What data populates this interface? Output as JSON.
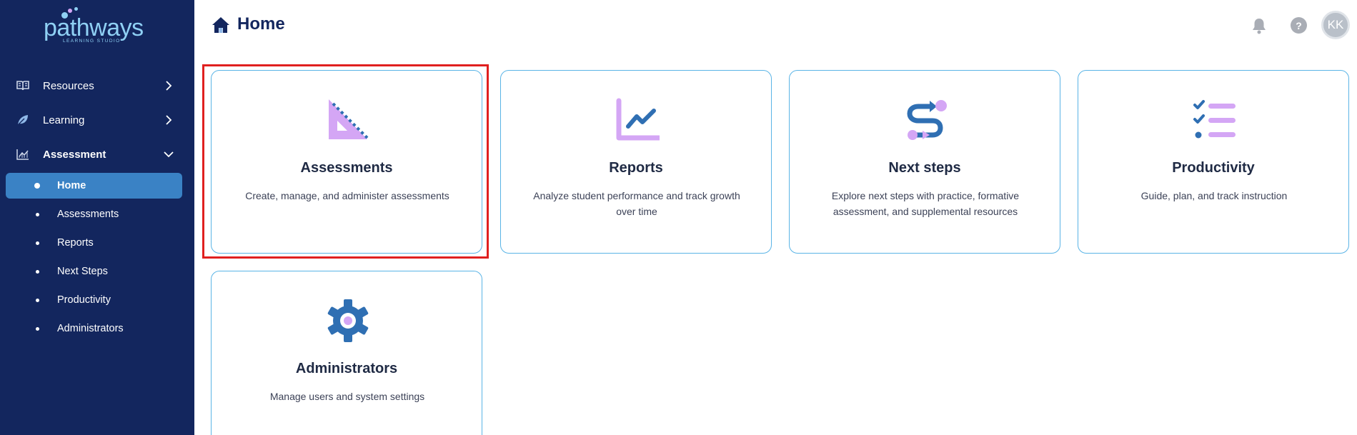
{
  "brand": {
    "word": "pathways",
    "sub": "LEARNING STUDIO"
  },
  "sidebar": {
    "items": [
      {
        "label": "Resources",
        "icon": "book-open-icon",
        "expanded": false
      },
      {
        "label": "Learning",
        "icon": "leaf-icon",
        "expanded": false
      },
      {
        "label": "Assessment",
        "icon": "chart-line-icon",
        "expanded": true
      }
    ],
    "sub_items": [
      {
        "label": "Home",
        "active": true
      },
      {
        "label": "Assessments",
        "active": false
      },
      {
        "label": "Reports",
        "active": false
      },
      {
        "label": "Next Steps",
        "active": false
      },
      {
        "label": "Productivity",
        "active": false
      },
      {
        "label": "Administrators",
        "active": false
      }
    ]
  },
  "header": {
    "title": "Home",
    "help_label": "?",
    "avatar_initials": "KK"
  },
  "cards": [
    {
      "title": "Assessments",
      "description": "Create, manage, and administer assessments",
      "icon": "triangle-ruler-icon",
      "selected": true
    },
    {
      "title": "Reports",
      "description": "Analyze student performance and track growth over time",
      "icon": "line-chart-icon",
      "selected": false
    },
    {
      "title": "Next steps",
      "description": "Explore next steps with practice, formative assessment, and supplemental resources",
      "icon": "route-icon",
      "selected": false
    },
    {
      "title": "Productivity",
      "description": "Guide, plan, and track instruction",
      "icon": "checklist-icon",
      "selected": false
    },
    {
      "title": "Administrators",
      "description": "Manage users and system settings",
      "icon": "gear-icon",
      "selected": false
    }
  ],
  "colors": {
    "sidebar_bg": "#13265e",
    "active_item": "#3a82c5",
    "card_border": "#5ab4e6",
    "icon_purple": "#d4a6f5",
    "icon_blue": "#2f6fb3",
    "highlight": "#e0201f"
  }
}
